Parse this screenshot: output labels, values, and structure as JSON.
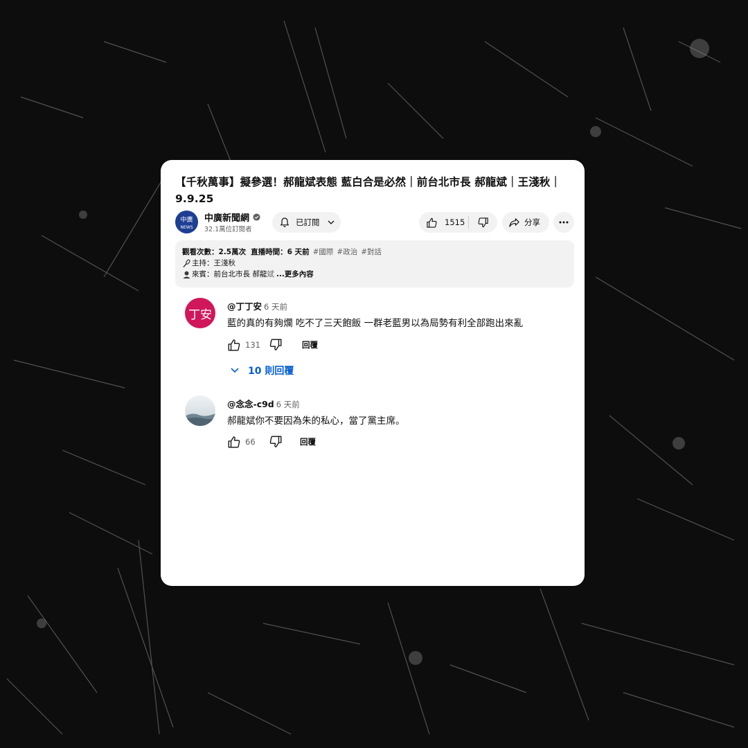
{
  "video": {
    "title": "【千秋萬事】擬參選！郝龍斌表態 藍白合是必然｜前台北市長 郝龍斌｜王淺秋｜9.9.25"
  },
  "channel": {
    "name": "中廣新聞網",
    "subscribers": "32.1萬位訂閱者",
    "logo_text": "中廣",
    "logo_sub": "NEWS"
  },
  "actions": {
    "subscribe_label": "已訂閱",
    "like_count": "1515",
    "share_label": "分享"
  },
  "description": {
    "views": "觀看次數：2.5萬次",
    "live": "直播時間：6 天前",
    "tags": [
      "#國際",
      "#政治",
      "#對話"
    ],
    "host": "主持：王淺秋",
    "guest": "來賓：前台北市長 郝龍",
    "guest_fade": "斌",
    "more_label": "...更多內容"
  },
  "comments": [
    {
      "author": "@丁丁安",
      "time": "6 天前",
      "avatar_text": "丁安",
      "avatar_color": "#d1175c",
      "text": "藍的真的有夠爛 吃不了三天飽飯 一群老藍男以為局勢有利全部跑出來亂",
      "likes": "131",
      "reply_label": "回覆",
      "replies_label": "10 則回覆"
    },
    {
      "author": "@念念-c9d",
      "time": "6 天前",
      "text": "郝龍斌你不要因為朱的私心，當了黨主席。",
      "likes": "66",
      "reply_label": "回覆"
    }
  ],
  "colors": {
    "background": "#0d0d0d",
    "card": "#ffffff",
    "chip": "#f2f2f2",
    "link_blue": "#065fd4"
  },
  "icons": [
    "bell-icon",
    "chevron-down-icon",
    "thumbs-up-icon",
    "thumbs-down-icon",
    "share-icon",
    "more-icon",
    "verified-icon",
    "microphone-icon",
    "person-icon"
  ]
}
